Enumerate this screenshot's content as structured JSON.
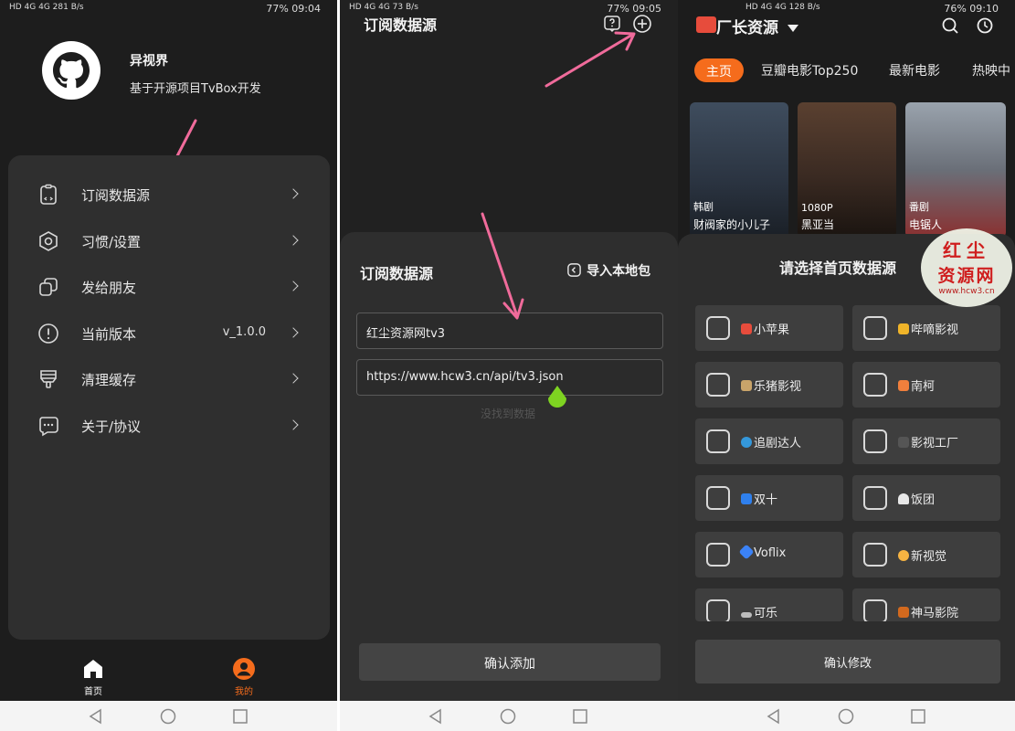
{
  "screen1": {
    "status": {
      "left": "HD 4G 4G 281 B/s",
      "right": "77% 09:04"
    },
    "profile": {
      "name": "异视界",
      "subtitle": "基于开源项目TvBox开发"
    },
    "menu": [
      {
        "label": "订阅数据源",
        "icon": "clipboard-icon"
      },
      {
        "label": "习惯/设置",
        "icon": "settings-icon"
      },
      {
        "label": "发给朋友",
        "icon": "share-icon"
      },
      {
        "label": "当前版本",
        "value": "v_1.0.0",
        "icon": "info-icon"
      },
      {
        "label": "清理缓存",
        "icon": "brush-icon"
      },
      {
        "label": "关于/协议",
        "icon": "chat-icon"
      }
    ],
    "bottom_nav": [
      {
        "label": "首页",
        "icon": "home-icon"
      },
      {
        "label": "我的",
        "icon": "user-icon"
      }
    ]
  },
  "screen2": {
    "status": {
      "left": "HD 4G 4G 73 B/s",
      "right": "77% 09:05"
    },
    "title": "订阅数据源",
    "sheet": {
      "title": "订阅数据源",
      "import_label": "导入本地包",
      "name_value": "红尘资源网tv3",
      "url_value": "https://www.hcw3.cn/api/tv3.json",
      "confirm_label": "确认添加"
    },
    "empty_text": "没找到数据"
  },
  "screen3": {
    "status": {
      "left": "HD 4G 4G 128 B/s",
      "right": "76% 09:10"
    },
    "source_name": "厂长资源",
    "tabs": [
      "主页",
      "豆瓣电影Top250",
      "最新电影",
      "热映中"
    ],
    "posters": [
      {
        "badge": "韩剧",
        "title": "财阀家的小儿子",
        "color": "#2f3b4a"
      },
      {
        "badge": "1080P",
        "title": "黑亚当",
        "color": "#3a2a22"
      },
      {
        "badge": "番剧",
        "title": "电锯人",
        "color": "#6a6f78"
      }
    ],
    "sheet": {
      "title": "请选择首页数据源",
      "items": [
        {
          "label": "小苹果",
          "color": "#e74c3c"
        },
        {
          "label": "哔嘀影视",
          "color": "#f0b429"
        },
        {
          "label": "乐猪影视",
          "color": "#c9a46a"
        },
        {
          "label": "南柯",
          "color": "#f07f3c"
        },
        {
          "label": "追剧达人",
          "color": "#3498db"
        },
        {
          "label": "影视工厂",
          "color": "#555555"
        },
        {
          "label": "双十",
          "color": "#2f80ed"
        },
        {
          "label": "饭团",
          "color": "#e8e8e8"
        },
        {
          "label": "Voflix",
          "color": "#3b82f6"
        },
        {
          "label": "新视觉",
          "color": "#f5b342"
        },
        {
          "label": "可乐",
          "color": "#bdbdbd"
        },
        {
          "label": "神马影院",
          "color": "#d2691e"
        }
      ],
      "confirm_label": "确认修改"
    },
    "watermark": {
      "line1": "红尘",
      "line2": "资源网",
      "url": "www.hcw3.cn"
    }
  },
  "colors": {
    "accent": "#f56c1c",
    "arrow": "#f06b9b",
    "drop": "#7ed321"
  }
}
